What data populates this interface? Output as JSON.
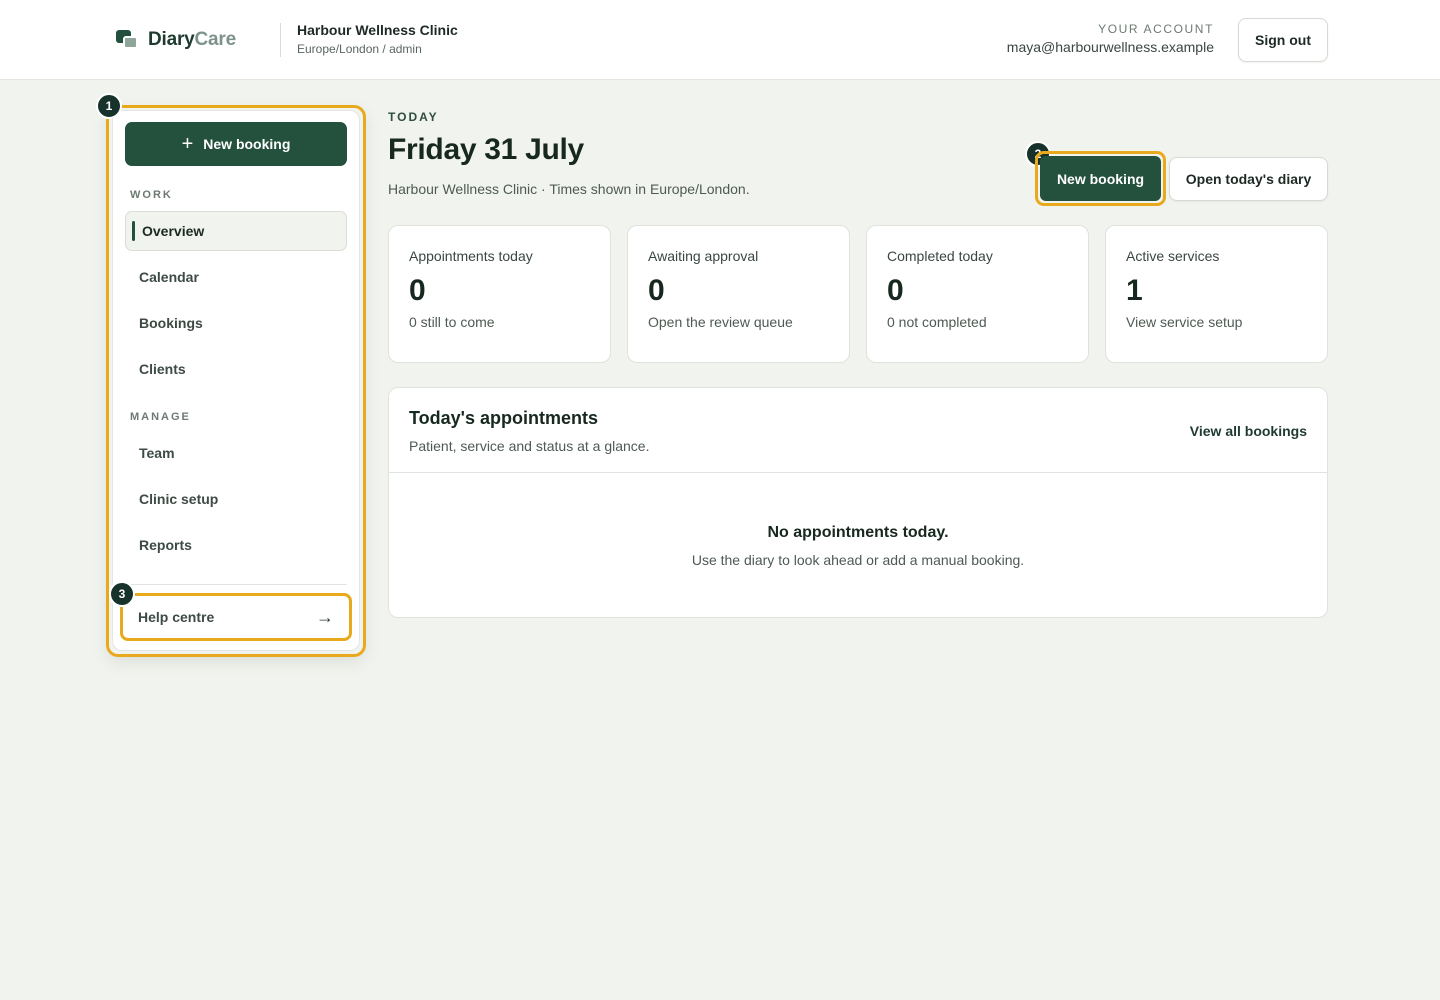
{
  "brand": {
    "name_primary": "Diary",
    "name_accent": "Care"
  },
  "clinic": {
    "name": "Harbour Wellness Clinic",
    "sub": "Europe/London / admin"
  },
  "account": {
    "label": "YOUR ACCOUNT",
    "email": "maya@harbourwellness.example",
    "signout_label": "Sign out"
  },
  "sidebar": {
    "new_booking_label": "New booking",
    "work_label": "WORK",
    "work_items": [
      "Overview",
      "Calendar",
      "Bookings",
      "Clients"
    ],
    "active_item": "Overview",
    "manage_label": "MANAGE",
    "manage_items": [
      "Team",
      "Clinic setup",
      "Reports"
    ],
    "help_label": "Help centre",
    "help_arrow": "→"
  },
  "badges": [
    "1",
    "2",
    "3"
  ],
  "main": {
    "kicker": "TODAY",
    "title": "Friday 31 July",
    "subtitle": "Harbour Wellness Clinic · Times shown in Europe/London.",
    "new_booking_label": "New booking",
    "open_diary_label": "Open today's diary"
  },
  "stats": [
    {
      "label": "Appointments today",
      "value": "0",
      "hint": "0 still to come"
    },
    {
      "label": "Awaiting approval",
      "value": "0",
      "hint": "Open the review queue"
    },
    {
      "label": "Completed today",
      "value": "0",
      "hint": "0 not completed"
    },
    {
      "label": "Active services",
      "value": "1",
      "hint": "View service setup"
    }
  ],
  "appointments": {
    "title": "Today's appointments",
    "subtitle": "Patient, service and status at a glance.",
    "view_all_label": "View all bookings",
    "empty_title": "No appointments today.",
    "empty_sub": "Use the diary to look ahead or add a manual booking."
  },
  "colors": {
    "brand_green": "#24503e",
    "highlight": "#e8a91c",
    "badge": "#17322a",
    "background": "#f1f3ee"
  }
}
